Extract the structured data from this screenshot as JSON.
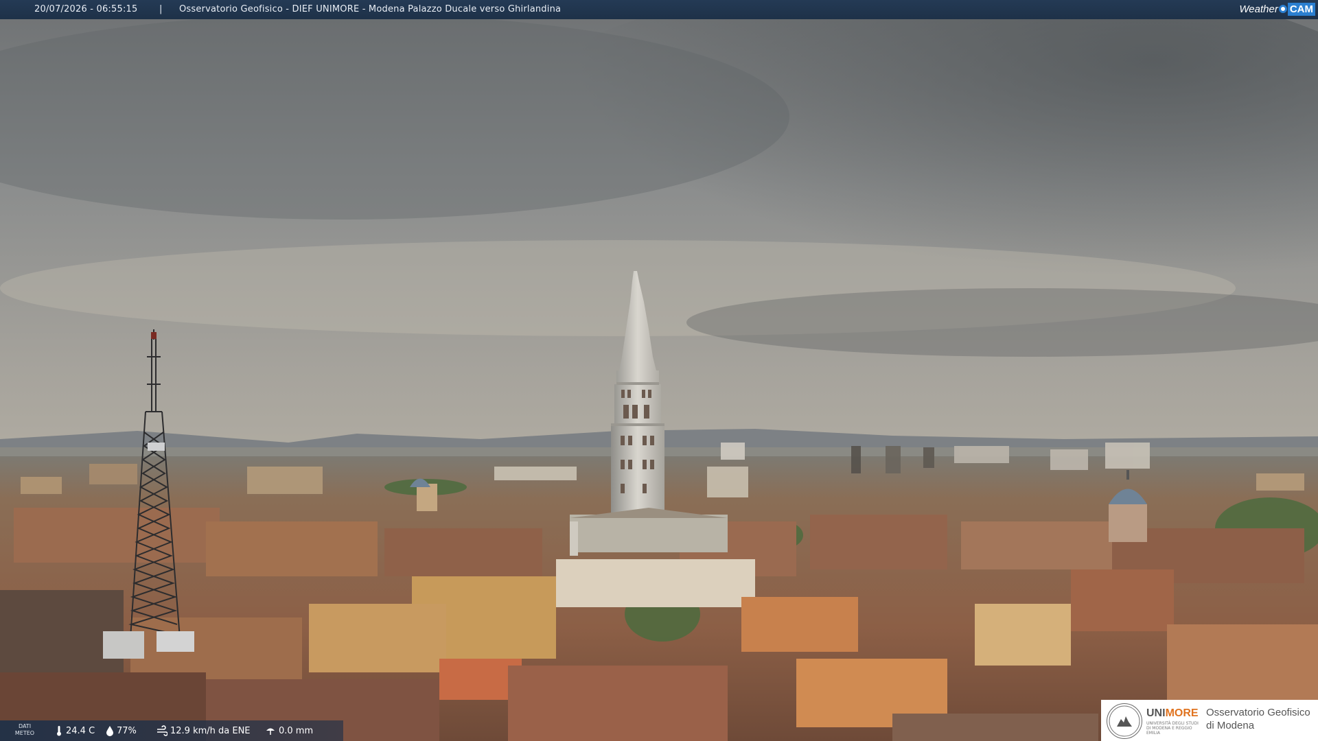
{
  "header": {
    "timestamp": "20/07/2026 - 06:55:15",
    "separator": "|",
    "title": "Osservatorio Geofisico - DIEF UNIMORE - Modena Palazzo Ducale verso Ghirlandina",
    "brand_weather": "Weather",
    "brand_cam": "CAM"
  },
  "meteo": {
    "label_line1": "DATI",
    "label_line2": "METEO",
    "temperature": "24.4 C",
    "humidity": "77%",
    "wind": "12.9 km/h da ENE",
    "rain": "0.0 mm",
    "icons": [
      "thermometer-icon",
      "humidity-icon",
      "wind-icon",
      "rain-icon"
    ]
  },
  "logo": {
    "uni_prefix": "UNI",
    "uni_suffix": "MORE",
    "uni_sub": "UNIVERSITÀ DEGLI STUDI DI MODENA E REGGIO EMILIA",
    "observatory_line1": "Osservatorio Geofisico",
    "observatory_line2": "di Modena"
  },
  "colors": {
    "header_bg": "#1e3148",
    "brand_blue": "#2b7fd0",
    "unimore_orange": "#e0731f",
    "sky": "#8f8c87",
    "roofs": "#8a5d44"
  }
}
